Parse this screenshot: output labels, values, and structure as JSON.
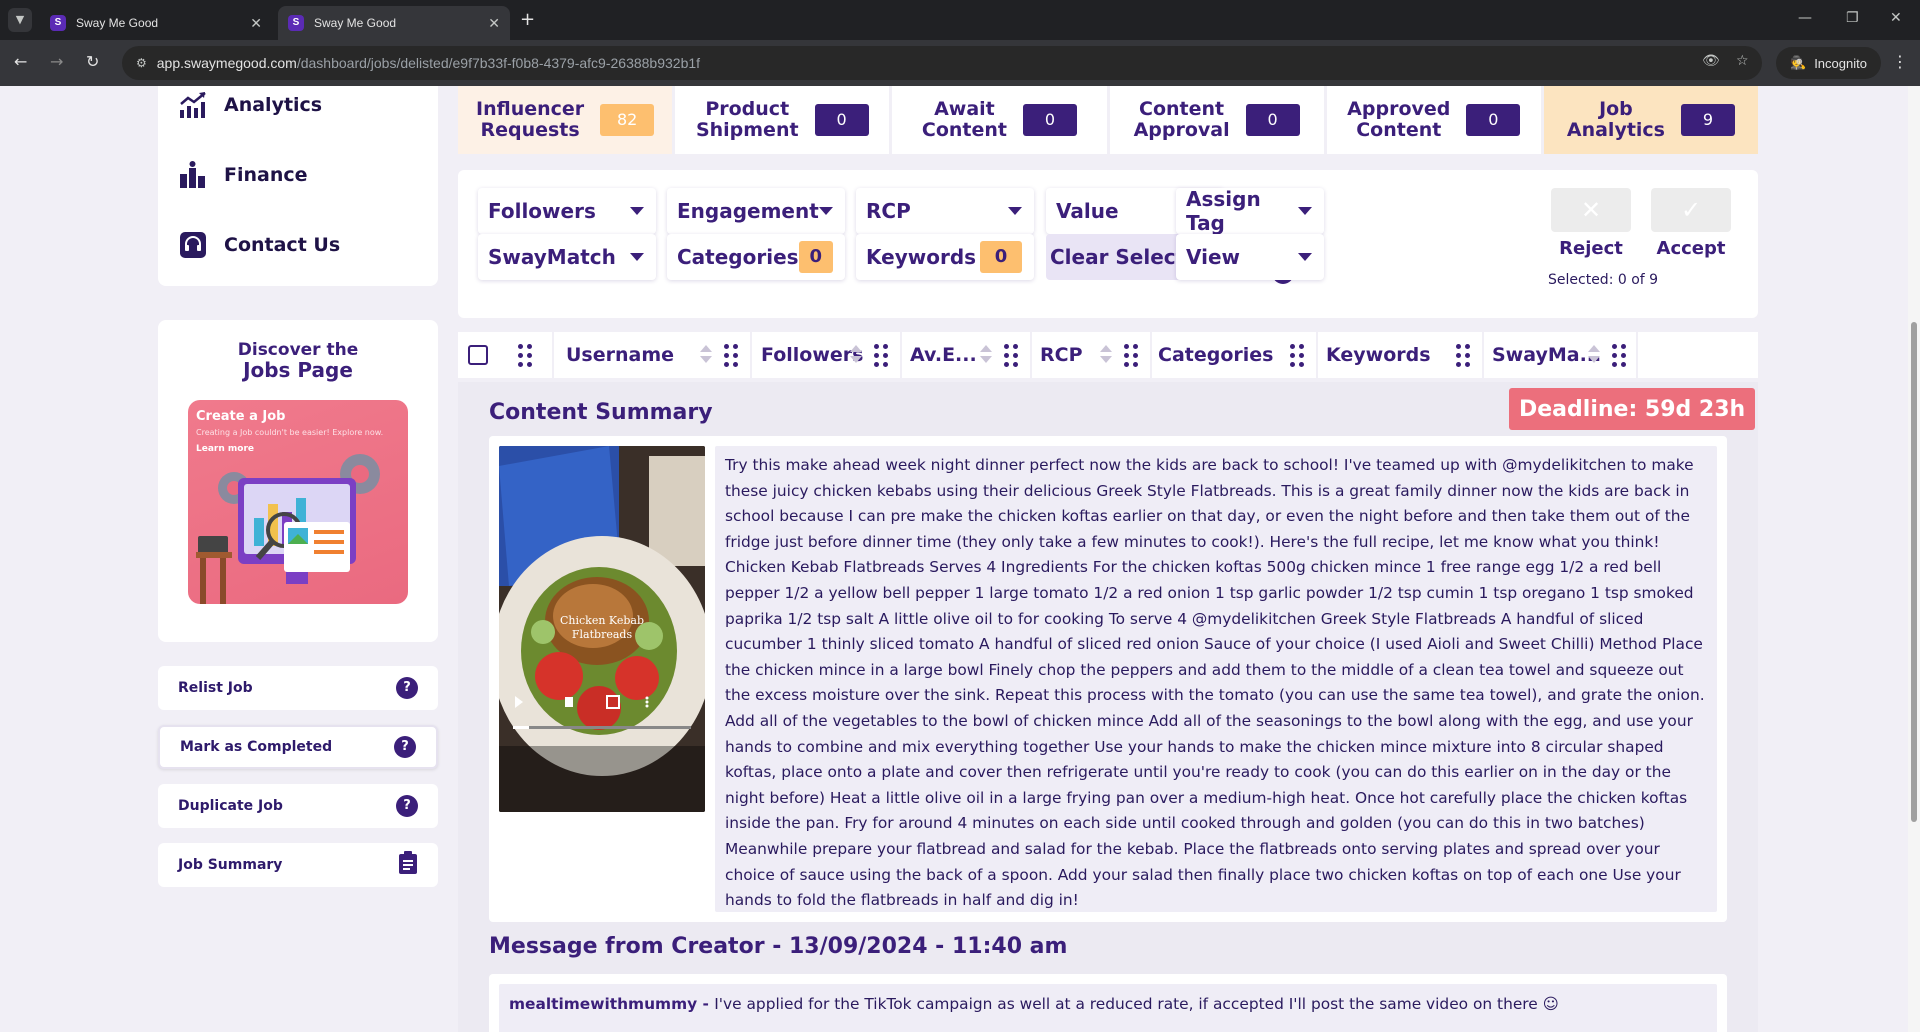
{
  "browser": {
    "tabs": [
      {
        "title": "Sway Me Good",
        "active": false
      },
      {
        "title": "Sway Me Good",
        "active": true
      }
    ],
    "url_host": "app.swaymegood.com",
    "url_path": "/dashboard/jobs/delisted/e9f7b33f-f0b8-4379-afc9-26388b932b1f",
    "incognito_label": "Incognito"
  },
  "sidebar": {
    "menu": [
      {
        "label": "Analytics",
        "icon": "analytics-chart-icon"
      },
      {
        "label": "Finance",
        "icon": "finance-coins-icon"
      },
      {
        "label": "Contact Us",
        "icon": "headset-icon"
      }
    ],
    "discover": {
      "title_line1": "Discover the",
      "title_line2": "Jobs Page",
      "promo_title": "Create a Job",
      "promo_subtitle": "Creating a Job couldn't be easier! Explore now.",
      "promo_link": "Learn more"
    },
    "actions": [
      {
        "label": "Relist Job",
        "icon": "question-icon"
      },
      {
        "label": "Mark as Completed",
        "icon": "question-icon"
      },
      {
        "label": "Duplicate Job",
        "icon": "question-icon"
      },
      {
        "label": "Job Summary",
        "icon": "clipboard-icon"
      }
    ]
  },
  "status_tabs": [
    {
      "line1": "Influencer",
      "line2": "Requests",
      "count": "82"
    },
    {
      "line1": "Product",
      "line2": "Shipment",
      "count": "0"
    },
    {
      "line1": "Await",
      "line2": "Content",
      "count": "0"
    },
    {
      "line1": "Content",
      "line2": "Approval",
      "count": "0"
    },
    {
      "line1": "Approved",
      "line2": "Content",
      "count": "0"
    },
    {
      "line1": "Job",
      "line2": "Analytics",
      "count": "9"
    }
  ],
  "filters": {
    "followers": "Followers",
    "engagement": "Engagement",
    "rcp": "RCP",
    "value": "Value",
    "swaymatch": "SwayMatch",
    "categories": "Categories",
    "categories_count": "0",
    "keywords": "Keywords",
    "keywords_count": "0",
    "clear_selection": "Clear Selection",
    "assign_tag": "Assign Tag",
    "view": "View",
    "help": "?",
    "reject": "Reject",
    "accept": "Accept",
    "selected_text": "Selected: 0 of 9"
  },
  "table_header": {
    "username": "Username",
    "followers": "Followers",
    "av_engagement": "Av.E...",
    "rcp": "RCP",
    "categories": "Categories",
    "keywords": "Keywords",
    "swaymatch": "SwayMa..."
  },
  "content": {
    "summary_title": "Content Summary",
    "deadline": "Deadline: 59d 23h",
    "video_caption": "Chicken Kebab Flatbreads",
    "summary_text": "Try this make ahead week night dinner perfect now the kids are back to school! I've teamed up with @mydelikitchen to make these juicy chicken kebabs using their delicious Greek Style Flatbreads. This is a great family dinner now the kids are back in school because I can pre make the chicken koftas earlier on that day, or even the night before and then take them out of the fridge just before dinner time (they only take a few minutes to cook!). Here's the full recipe, let me know what you think! Chicken Kebab Flatbreads Serves 4 Ingredients For the chicken koftas 500g chicken mince 1 free range egg 1/2 a red bell pepper 1/2 a yellow bell pepper 1 large tomato 1/2 a red onion 1 tsp garlic powder 1/2 tsp cumin 1 tsp oregano 1 tsp smoked paprika 1/2 tsp salt A little olive oil to for cooking To serve 4 @mydelikitchen Greek Style Flatbreads A handful of sliced cucumber 1 thinly sliced tomato A handful of sliced red onion Sauce of your choice (I used Aioli and Sweet Chilli) Method Place the chicken mince in a large bowl Finely chop the peppers and add them to the middle of a clean tea towel and squeeze out the excess moisture over the sink. Repeat this process with the tomato (you can use the same tea towel), and grate the onion. Add all of the vegetables to the bowl of chicken mince Add all of the seasonings to the bowl along with the egg, and use your hands to combine and mix everything together Use your hands to make the chicken mince mixture into 8 circular shaped koftas, place onto a plate and cover then refrigerate until you're ready to cook (you can do this earlier on in the day or the night before) Heat a little olive oil in a large frying pan over a medium-high heat. Once hot carefully place the chicken koftas inside the pan. Fry for around 4 minutes on each side until cooked through and golden (you can do this in two batches) Meanwhile prepare your flatbread and salad for the kebab. Place the flatbreads onto serving plates and spread over your choice of sauce using the back of a spoon. Add your salad then finally place two chicken koftas on top of each one Use your hands to fold the flatbreads in half and dig in!",
    "message_title": "Message from Creator - 13/09/2024 - 11:40 am",
    "message_author": "mealtimewithmummy",
    "message_separator": " - ",
    "message_text": "I've applied for the TikTok campaign as well at a reduced rate, if accepted I'll post the same video on there ☺"
  }
}
